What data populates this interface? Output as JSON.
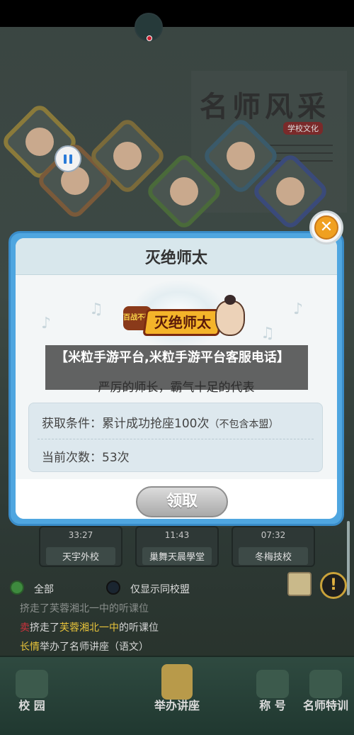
{
  "background": {
    "banner_title": "名师风采",
    "banner_subtitle": "学校文化",
    "timers": [
      {
        "time": "33:27",
        "school": "天宇外校"
      },
      {
        "time": "11:43",
        "school": "巢舞天晨學堂"
      },
      {
        "time": "07:32",
        "school": "冬梅技校"
      }
    ],
    "filters": {
      "all_label": "全部",
      "same_school_label": "仅显示同校盟"
    },
    "feed": [
      {
        "who": "",
        "text": "挤走了芙蓉湘北一中的听课位",
        "who_color": "red"
      },
      {
        "who": "卖",
        "text": "挤走了",
        "target": "芙蓉湘北一中",
        "rest": "的听课位"
      },
      {
        "who": "长情",
        "text": "举办了名师讲座（语文）"
      }
    ],
    "bottom_nav": [
      {
        "label": "校 园",
        "icon": "campus-icon"
      },
      {
        "label": "举办讲座",
        "icon": "lecture-icon"
      },
      {
        "label": "称 号",
        "icon": "title-icon"
      },
      {
        "label": "名师特训",
        "icon": "teacher-training-icon"
      }
    ]
  },
  "modal": {
    "title": "灭绝师太",
    "badge_text": "灭绝师太",
    "badge_prefix": "百战不殆",
    "description": "严厉的师长，霸气十足的代表",
    "condition_label": "获取条件：累计成功抢座100次",
    "condition_note": "（不包含本盟）",
    "current_label": "当前次数：53次",
    "claim_button": "领取"
  },
  "caption": "【米粒手游平台,米粒手游平台客服电话】",
  "colors": {
    "modal_border": "#4fa6e0",
    "close_button": "#f0a020",
    "badge_gold": "#f4b42a",
    "feed_red": "#d2323c",
    "feed_yellow": "#e8c33a"
  }
}
